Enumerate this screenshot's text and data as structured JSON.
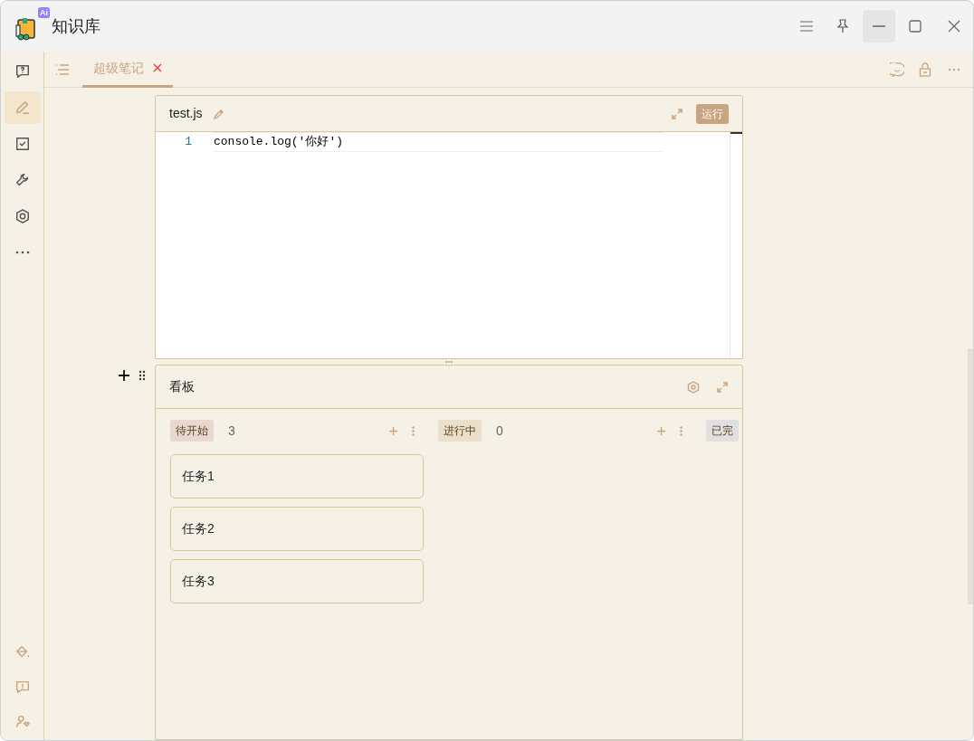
{
  "window": {
    "title": "知识库",
    "logo_badge": "Ai"
  },
  "sidebar": {
    "items": [
      {
        "kind": "help",
        "selected": false
      },
      {
        "kind": "edit",
        "selected": true
      },
      {
        "kind": "task",
        "selected": false
      },
      {
        "kind": "tool",
        "selected": false
      },
      {
        "kind": "settings",
        "selected": false
      },
      {
        "kind": "more",
        "selected": false
      }
    ],
    "bottom": [
      {
        "kind": "paint"
      },
      {
        "kind": "feedback"
      },
      {
        "kind": "user"
      }
    ]
  },
  "tabs": [
    {
      "label": "超级笔记",
      "selected": true
    }
  ],
  "code_block": {
    "filename": "test.js",
    "run_button": "运行",
    "lines": [
      {
        "number": "1",
        "code": "console.log('你好')"
      }
    ]
  },
  "kanban": {
    "title": "看板",
    "columns": [
      {
        "label": "待开始",
        "color": "#e8d8cf",
        "count": "3",
        "cards": [
          "任务1",
          "任务2",
          "任务3"
        ]
      },
      {
        "label": "进行中",
        "color": "#eadfcb",
        "count": "0"
      },
      {
        "label": "已完",
        "color": "#dfe0df"
      }
    ]
  }
}
